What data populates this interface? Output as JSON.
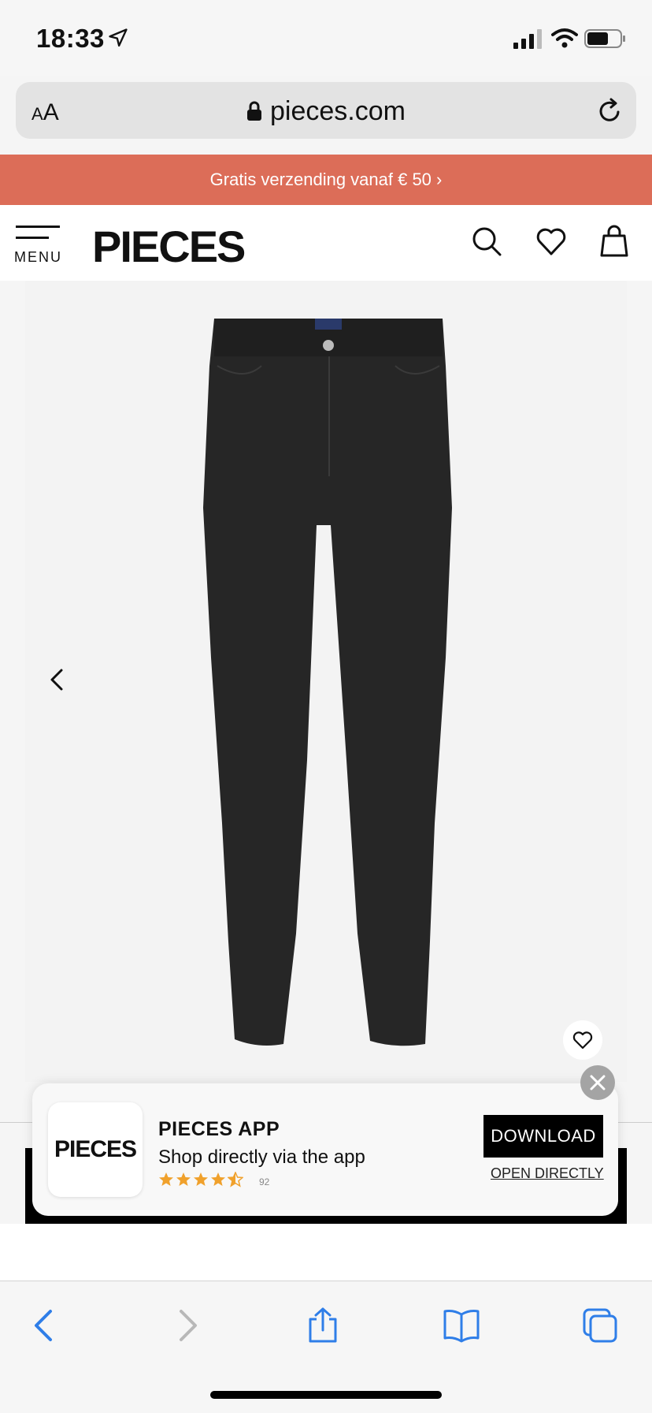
{
  "status_bar": {
    "time": "18:33"
  },
  "url_bar": {
    "text_size_label_small": "A",
    "text_size_label_large": "A",
    "domain": "pieces.com"
  },
  "promo": {
    "text": "Gratis verzending vanaf € 50 ›"
  },
  "header": {
    "menu_label": "MENU",
    "logo": "PIECES"
  },
  "app_banner": {
    "icon_text": "PIECES",
    "app_name": "PIECES APP",
    "description": "Shop directly via the app",
    "rating_stars": 4.5,
    "rating_count": "92",
    "download_label": "DOWNLOAD",
    "open_label": "OPEN DIRECTLY"
  },
  "colors": {
    "promo_bg": "#dc6d58",
    "accent_blue": "#2f7ee8",
    "star": "#f0a12c"
  },
  "icons": {
    "location": "location-arrow-icon",
    "lock": "lock-icon",
    "reload": "reload-icon",
    "search": "search-icon",
    "wishlist": "heart-icon",
    "bag": "shopping-bag-icon",
    "prev": "chevron-left-icon",
    "close": "close-icon",
    "share": "share-icon",
    "bookmarks": "book-icon",
    "tabs": "tabs-icon"
  }
}
